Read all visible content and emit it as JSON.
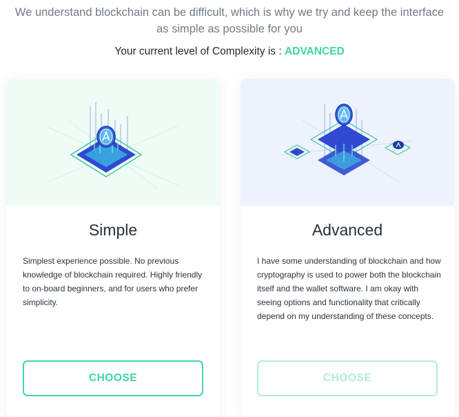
{
  "intro": {
    "line1": "We understand blockchain can be difficult, which is why we try and keep the interface",
    "line2": "as simple as possible for you"
  },
  "level": {
    "prefix": "Your current level of Complexity is : ",
    "value": "ADVANCED"
  },
  "cards": [
    {
      "title": "Simple",
      "description": "Simplest experience possible. No previous knowledge of blockchain required. Highly friendly to on-board beginners, and for users who prefer simplicity.",
      "button_label": "CHOOSE",
      "button_state": "enabled",
      "illustration_icon": "blockchain-coin-icon"
    },
    {
      "title": "Advanced",
      "description": "I have some understanding of blockchain and how cryptography is used to power both the blockchain itself and the wallet software. I am okay with seeing options and functionality that critically depend on my understanding of these concepts.",
      "button_label": "CHOOSE",
      "button_state": "disabled",
      "illustration_icon": "blockchain-network-icon"
    }
  ],
  "colors": {
    "accent": "#3fd4a8",
    "accent_disabled": "#aeecd9",
    "simple_hero_bg": "#effcf5",
    "advanced_hero_bg": "#eef2fc",
    "text_muted": "#707a85"
  }
}
